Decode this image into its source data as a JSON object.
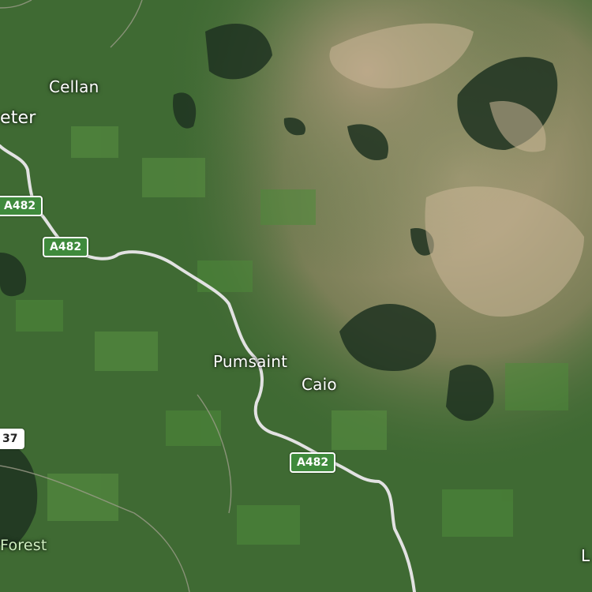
{
  "map": {
    "places": {
      "cellan": "Cellan",
      "lampeter_fragment": "eter",
      "pumsaint": "Pumsaint",
      "caio": "Caio",
      "forest_fragment": "Forest",
      "edge_fragment": "L"
    },
    "roads": {
      "a482_1": "A482",
      "a482_2": "A482",
      "a482_3": "A482",
      "road_37": "37"
    },
    "colors": {
      "field_green": "#3f6a33",
      "dark_forest": "#1f3321",
      "upland_tan": "#b7a483",
      "road_line": "#d9d9d9",
      "road_shield": "#3f8a3c"
    }
  }
}
